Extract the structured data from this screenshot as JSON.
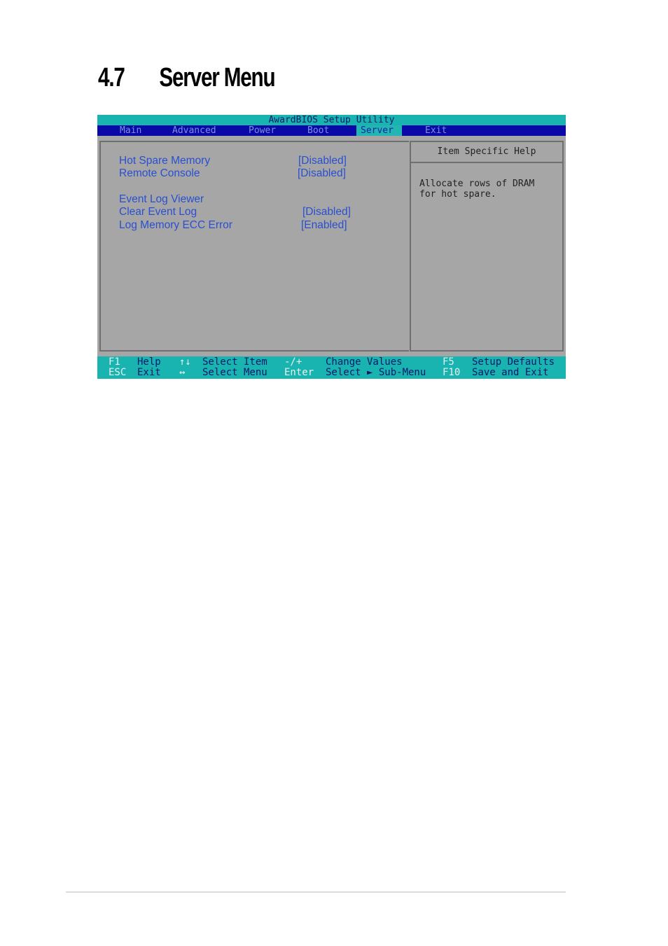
{
  "section": {
    "number": "4.7",
    "title": "Server Menu"
  },
  "bios": {
    "title": "AwardBIOS Setup Utility",
    "menu": [
      {
        "label": "Main",
        "active": false
      },
      {
        "label": "Advanced",
        "active": false
      },
      {
        "label": "Power",
        "active": false
      },
      {
        "label": "Boot",
        "active": false
      },
      {
        "label": "Server",
        "active": true
      },
      {
        "label": "Exit",
        "active": false
      }
    ],
    "options": [
      {
        "label": "Hot Spare Memory",
        "value": "[Disabled]"
      },
      {
        "label": "Remote Console",
        "value": "[Disabled]"
      },
      {
        "label": "Event Log Viewer",
        "value": ""
      },
      {
        "label": "Clear Event Log",
        "value": "[Disabled]"
      },
      {
        "label": "Log Memory ECC Error",
        "value": "[Enabled]"
      }
    ],
    "help": {
      "title": "Item Specific Help",
      "text": "Allocate rows of DRAM\nfor hot spare."
    },
    "status_bar": [
      {
        "key": "F1",
        "desc": "Help"
      },
      {
        "key": "ESC",
        "desc": "Exit"
      },
      {
        "key": "↑↓",
        "desc": "Select Item"
      },
      {
        "key": "↔",
        "desc": "Select Menu"
      },
      {
        "key": "-/+",
        "desc": "Change Values"
      },
      {
        "key": "Enter",
        "desc": "Select ► Sub-Menu"
      },
      {
        "key": "F5",
        "desc": "Setup Defaults"
      },
      {
        "key": "F10",
        "desc": "Save and Exit"
      }
    ]
  },
  "colors": {
    "bios_teal": "#19b3b0",
    "bios_menu_blue": "#0a09a8",
    "bios_panel_gray": "#a6a6a6",
    "bios_option_blue": "#2a4fd0"
  }
}
